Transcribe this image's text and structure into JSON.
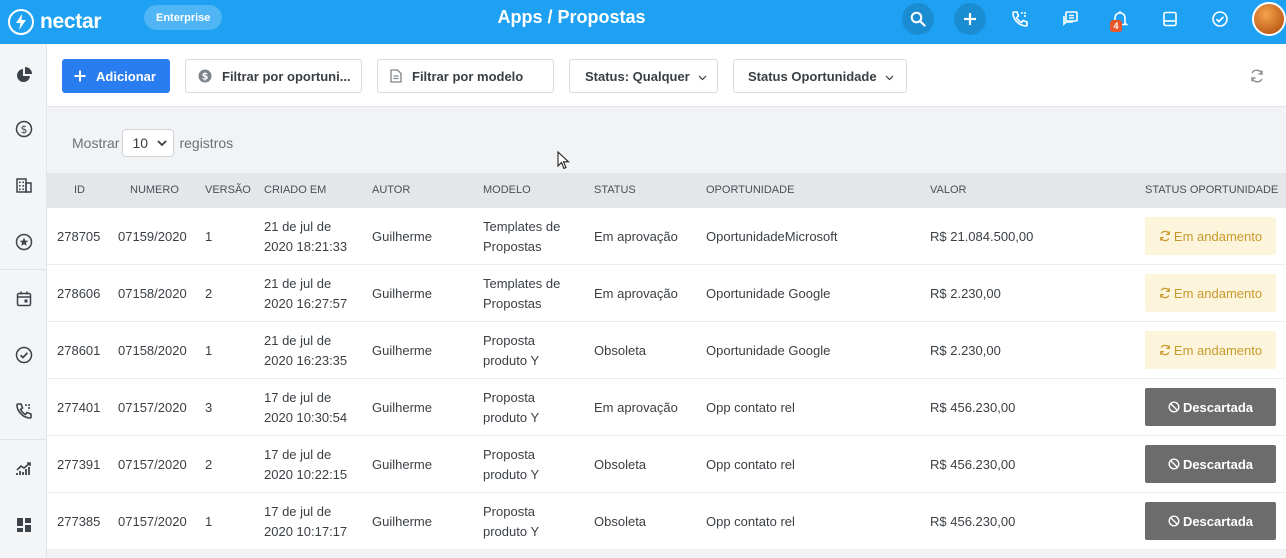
{
  "header": {
    "logo_text": "nectar",
    "edition": "Enterprise",
    "title": "Apps / Propostas",
    "notification_count": "4",
    "icons": [
      "search-icon",
      "plus-icon",
      "phone-icon",
      "chat-icon",
      "bell-icon",
      "inbox-icon",
      "check-circle-icon",
      "avatar"
    ]
  },
  "sidebar": {
    "items": [
      "pie-chart-icon",
      "dollar-icon",
      "building-icon",
      "star-icon",
      "calendar-icon",
      "check-circle-icon",
      "phone-icon",
      "trending-up-icon",
      "dashboard-icon"
    ]
  },
  "toolbar": {
    "add_label": "Adicionar",
    "filter_opportunity": "Filtrar por oportuni...",
    "filter_model": "Filtrar por modelo",
    "status_filter": "Status: Qualquer",
    "opportunity_status": "Status Oportunidade"
  },
  "list_controls": {
    "show_label": "Mostrar",
    "page_size": "10",
    "records_label": "registros"
  },
  "table": {
    "columns": [
      "ID",
      "NUMERO",
      "VERSÃO",
      "CRIADO EM",
      "AUTOR",
      "MODELO",
      "STATUS",
      "OPORTUNIDADE",
      "VALOR",
      "STATUS OPORTUNIDADE"
    ],
    "rows": [
      {
        "id": "278705",
        "numero": "07159/2020",
        "versao": "1",
        "criado1": "21 de jul de",
        "criado2": "2020 18:21:33",
        "autor": "Guilherme",
        "modelo1": "Templates de",
        "modelo2": "Propostas",
        "status": "Em aprovação",
        "oportunidade": "OportunidadeMicrosoft",
        "valor": "R$ 21.084.500,00",
        "status_op": "Em andamento",
        "status_kind": "going"
      },
      {
        "id": "278606",
        "numero": "07158/2020",
        "versao": "2",
        "criado1": "21 de jul de",
        "criado2": "2020 16:27:57",
        "autor": "Guilherme",
        "modelo1": "Templates de",
        "modelo2": "Propostas",
        "status": "Em aprovação",
        "oportunidade": "Oportunidade Google",
        "valor": "R$ 2.230,00",
        "status_op": "Em andamento",
        "status_kind": "going"
      },
      {
        "id": "278601",
        "numero": "07158/2020",
        "versao": "1",
        "criado1": "21 de jul de",
        "criado2": "2020 16:23:35",
        "autor": "Guilherme",
        "modelo1": "Proposta",
        "modelo2": "produto Y",
        "status": "Obsoleta",
        "oportunidade": "Oportunidade Google",
        "valor": "R$ 2.230,00",
        "status_op": "Em andamento",
        "status_kind": "going"
      },
      {
        "id": "277401",
        "numero": "07157/2020",
        "versao": "3",
        "criado1": "17 de jul de",
        "criado2": "2020 10:30:54",
        "autor": "Guilherme",
        "modelo1": "Proposta",
        "modelo2": "produto Y",
        "status": "Em aprovação",
        "oportunidade": "Opp contato rel",
        "valor": "R$ 456.230,00",
        "status_op": "Descartada",
        "status_kind": "discard"
      },
      {
        "id": "277391",
        "numero": "07157/2020",
        "versao": "2",
        "criado1": "17 de jul de",
        "criado2": "2020 10:22:15",
        "autor": "Guilherme",
        "modelo1": "Proposta",
        "modelo2": "produto Y",
        "status": "Obsoleta",
        "oportunidade": "Opp contato rel",
        "valor": "R$ 456.230,00",
        "status_op": "Descartada",
        "status_kind": "discard"
      },
      {
        "id": "277385",
        "numero": "07157/2020",
        "versao": "1",
        "criado1": "17 de jul de",
        "criado2": "2020 10:17:17",
        "autor": "Guilherme",
        "modelo1": "Proposta",
        "modelo2": "produto Y",
        "status": "Obsoleta",
        "oportunidade": "Opp contato rel",
        "valor": "R$ 456.230,00",
        "status_op": "Descartada",
        "status_kind": "discard"
      }
    ]
  },
  "colors": {
    "header_bg": "#1ea1f2",
    "primary": "#2a7df1",
    "going_bg": "#fdf4dc",
    "going_text": "#c89a2c",
    "discard_bg": "#6c6c6c"
  }
}
